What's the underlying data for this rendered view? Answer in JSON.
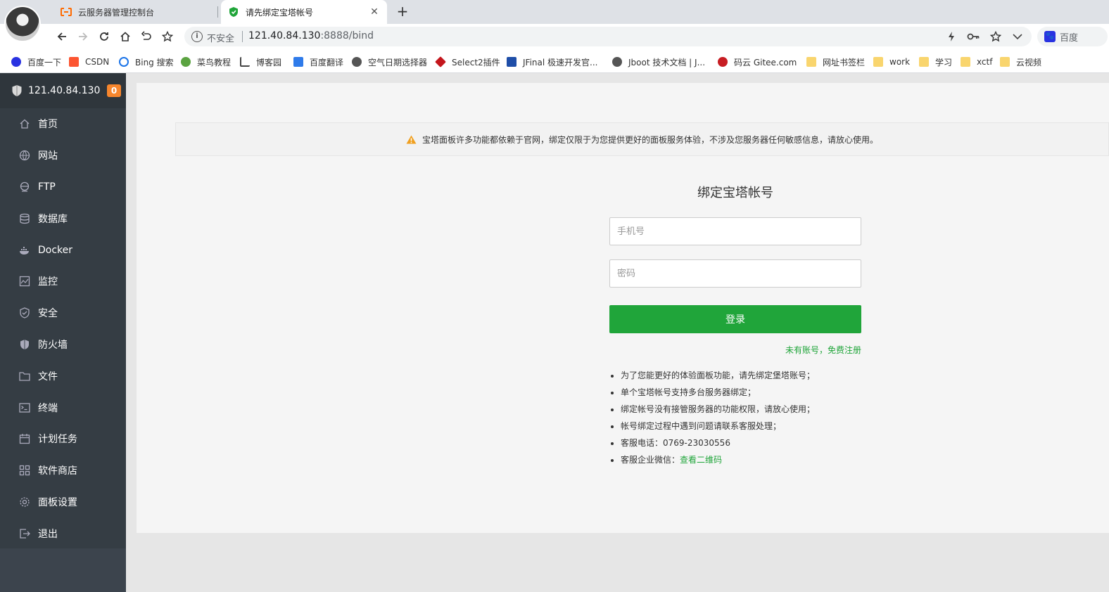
{
  "browser": {
    "tabs": [
      {
        "title": "云服务器管理控制台"
      },
      {
        "title": "请先绑定宝塔帐号"
      }
    ],
    "omnibox": {
      "security_label": "不安全",
      "url_host": "121.40.84.130",
      "url_rest": ":8888/bind"
    },
    "search_engine_label": "百度",
    "bookmarks": [
      {
        "label": "百度一下",
        "color": "#2932e1"
      },
      {
        "label": "CSDN",
        "color": "#fc5531"
      },
      {
        "label": "Bing 搜索",
        "color": "#1a73e8"
      },
      {
        "label": "菜鸟教程",
        "color": "#5ba341"
      },
      {
        "label": "博客园",
        "color": "#444444"
      },
      {
        "label": "百度翻译",
        "color": "#2f7bea"
      },
      {
        "label": "空气日期选择器",
        "color": "#555555"
      },
      {
        "label": "Select2插件",
        "color": "#c4161c"
      },
      {
        "label": "JFinal 极速开发官...",
        "color": "#1f4ea8"
      },
      {
        "label": "Jboot 技术文档 | J...",
        "color": "#555555"
      },
      {
        "label": "码云 Gitee.com",
        "color": "#c71d23"
      },
      {
        "label": "网址书签栏",
        "color": "#f9d56e"
      },
      {
        "label": "work",
        "color": "#f9d56e"
      },
      {
        "label": "学习",
        "color": "#f9d56e"
      },
      {
        "label": "xctf",
        "color": "#f9d56e"
      },
      {
        "label": "云视频",
        "color": "#f9d56e"
      }
    ]
  },
  "sidebar": {
    "host": "121.40.84.130",
    "badge": "0",
    "items": [
      {
        "label": "首页",
        "icon": "home-icon"
      },
      {
        "label": "网站",
        "icon": "globe-icon"
      },
      {
        "label": "FTP",
        "icon": "ftp-icon"
      },
      {
        "label": "数据库",
        "icon": "database-icon"
      },
      {
        "label": "Docker",
        "icon": "docker-icon"
      },
      {
        "label": "监控",
        "icon": "monitor-icon"
      },
      {
        "label": "安全",
        "icon": "shield-check-icon"
      },
      {
        "label": "防火墙",
        "icon": "shield-icon"
      },
      {
        "label": "文件",
        "icon": "folder-icon"
      },
      {
        "label": "终端",
        "icon": "terminal-icon"
      },
      {
        "label": "计划任务",
        "icon": "calendar-icon"
      },
      {
        "label": "软件商店",
        "icon": "apps-icon"
      },
      {
        "label": "面板设置",
        "icon": "gear-icon"
      },
      {
        "label": "退出",
        "icon": "logout-icon"
      }
    ]
  },
  "main": {
    "notice": "宝塔面板许多功能都依赖于官网，绑定仅限于为您提供更好的面板服务体验，不涉及您服务器任何敏感信息，请放心使用。",
    "title": "绑定宝塔帐号",
    "phone_placeholder": "手机号",
    "password_placeholder": "密码",
    "login_label": "登录",
    "register_link": "未有账号，免费注册",
    "tips": [
      "为了您能更好的体验面板功能，请先绑定堡塔账号；",
      "单个宝塔帐号支持多台服务器绑定；",
      "绑定帐号没有接管服务器的功能权限，请放心使用；",
      "帐号绑定过程中遇到问题请联系客服处理；",
      "客服电话：0769-23030556"
    ],
    "wechat_label": "客服企业微信：",
    "wechat_link": "查看二维码"
  },
  "colors": {
    "accent_green": "#20a53a",
    "sidebar_bg": "#3c444d",
    "badge_orange": "#f7862d"
  }
}
